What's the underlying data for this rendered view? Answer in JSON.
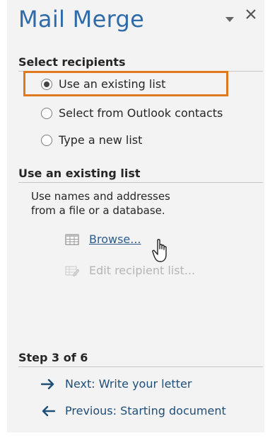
{
  "pane": {
    "title": "Mail Merge",
    "menu_icon": "dropdown-triangle-icon",
    "close_icon": "close-x-icon"
  },
  "select_recipients": {
    "heading": "Select recipients",
    "options": [
      {
        "label": "Use an existing list",
        "checked": true
      },
      {
        "label": "Select from Outlook contacts",
        "checked": false
      },
      {
        "label": "Type a new list",
        "checked": false
      }
    ]
  },
  "existing_list": {
    "heading": "Use an existing list",
    "description_line1": "Use names and addresses",
    "description_line2": "from a file or a database.",
    "browse_label": "Browse...",
    "edit_label": "Edit recipient list..."
  },
  "step": {
    "heading": "Step 3 of 6",
    "next_label": "Next: Write your letter",
    "previous_label": "Previous: Starting document"
  },
  "colors": {
    "title": "#2e6ba8",
    "highlight": "#e07a1f",
    "link": "#2e5c8a",
    "step_link": "#1f4e79"
  }
}
